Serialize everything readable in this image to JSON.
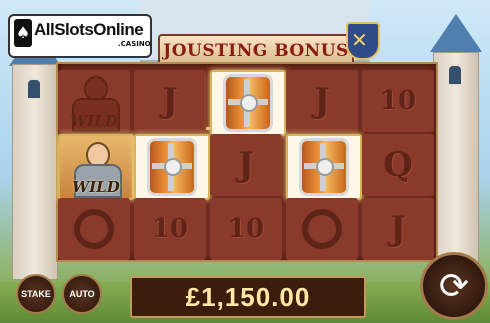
{
  "logo": {
    "text": "AllSlotsOnline",
    "sub": ".CASINO",
    "card": "♠"
  },
  "title": "JOUSTING BONUS",
  "crest_icon": "✕",
  "reels": [
    [
      {
        "s": "wild",
        "wild": "WILD",
        "lit": false
      },
      {
        "s": "wild",
        "wild": "WILD",
        "lit": true
      },
      {
        "s": "knot",
        "lit": false
      }
    ],
    [
      {
        "s": "text",
        "v": "J",
        "lit": false
      },
      {
        "s": "shield",
        "lit": true
      },
      {
        "s": "text",
        "v": "10",
        "lit": false
      }
    ],
    [
      {
        "s": "shield",
        "lit": true
      },
      {
        "s": "text",
        "v": "J",
        "lit": false
      },
      {
        "s": "text",
        "v": "10",
        "lit": false
      }
    ],
    [
      {
        "s": "text",
        "v": "J",
        "lit": false
      },
      {
        "s": "shield",
        "lit": true
      },
      {
        "s": "knot",
        "lit": false
      }
    ],
    [
      {
        "s": "text",
        "v": "10",
        "lit": false
      },
      {
        "s": "text",
        "v": "Q",
        "lit": false
      },
      {
        "s": "text",
        "v": "J",
        "lit": false
      }
    ]
  ],
  "buttons": {
    "stake": "STAKE",
    "auto": "AUTO"
  },
  "win_amount": "£1,150.00",
  "spin_icon": "⟳"
}
